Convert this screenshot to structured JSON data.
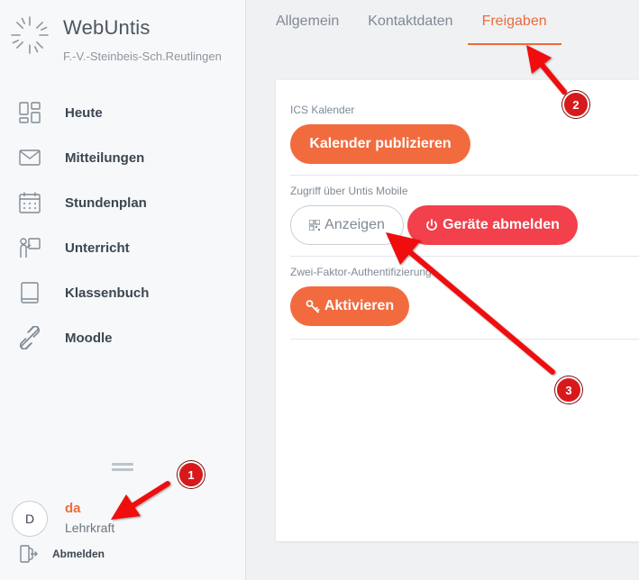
{
  "brand": {
    "title": "WebUntis",
    "school": "F.-V.-Steinbeis-Sch.Reutlingen"
  },
  "sidebar": {
    "items": [
      {
        "label": "Heute",
        "icon": "dashboard-icon"
      },
      {
        "label": "Mitteilungen",
        "icon": "envelope-icon"
      },
      {
        "label": "Stundenplan",
        "icon": "calendar-icon"
      },
      {
        "label": "Unterricht",
        "icon": "teacher-board-icon"
      },
      {
        "label": "Klassenbuch",
        "icon": "book-icon"
      },
      {
        "label": "Moodle",
        "icon": "link-icon"
      }
    ]
  },
  "user": {
    "avatar_initial": "D",
    "name": "da",
    "role": "Lehrkraft",
    "logout_label": "Abmelden"
  },
  "tabs": [
    {
      "label": "Allgemein",
      "active": false
    },
    {
      "label": "Kontaktdaten",
      "active": false
    },
    {
      "label": "Freigaben",
      "active": true
    }
  ],
  "sections": {
    "ics": {
      "label": "ICS Kalender",
      "button": "Kalender publizieren"
    },
    "mobile": {
      "label": "Zugriff über Untis Mobile",
      "show_button": "Anzeigen",
      "logout_devices_button": "Geräte abmelden"
    },
    "twofa": {
      "label": "Zwei-Faktor-Authentifizierung",
      "button": "Aktivieren"
    }
  },
  "annotations": {
    "markers": [
      "1",
      "2",
      "3"
    ],
    "color": "#d7191c"
  },
  "colors": {
    "accent": "#ee6a3b",
    "primary_button": "#f26b3f",
    "danger_button": "#f2404c"
  }
}
